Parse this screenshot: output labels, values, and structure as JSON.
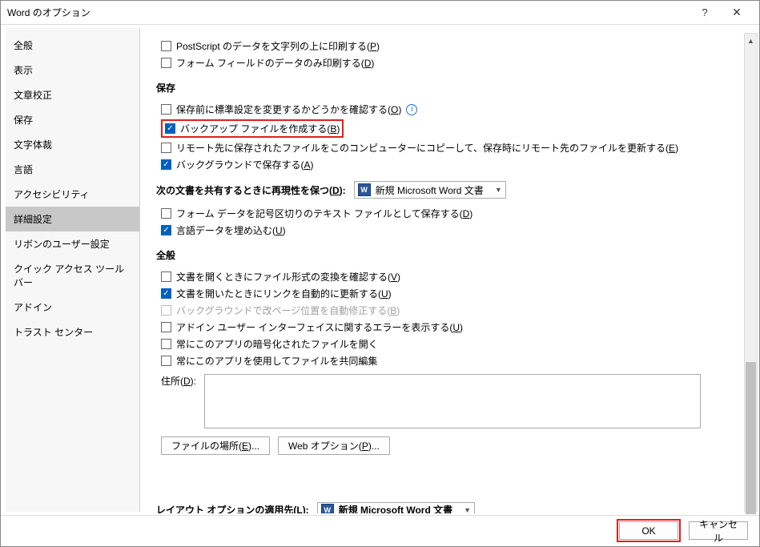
{
  "window": {
    "title": "Word のオプション"
  },
  "sidebar": {
    "items": [
      {
        "label": "全般"
      },
      {
        "label": "表示"
      },
      {
        "label": "文章校正"
      },
      {
        "label": "保存"
      },
      {
        "label": "文字体裁"
      },
      {
        "label": "言語"
      },
      {
        "label": "アクセシビリティ"
      },
      {
        "label": "詳細設定"
      },
      {
        "label": "リボンのユーザー設定"
      },
      {
        "label": "クイック アクセス ツール バー"
      },
      {
        "label": "アドイン"
      },
      {
        "label": "トラスト センター"
      }
    ],
    "selected_index": 7
  },
  "top_checks": [
    {
      "label": "PostScript のデータを文字列の上に印刷する(",
      "accel": "P",
      "suffix": ")",
      "checked": false
    },
    {
      "label": "フォーム フィールドのデータのみ印刷する(",
      "accel": "D",
      "suffix": ")",
      "checked": false
    }
  ],
  "sections": {
    "save": {
      "title": "保存",
      "items": [
        {
          "label": "保存前に標準設定を変更するかどうかを確認する(",
          "accel": "O",
          "suffix": ")",
          "checked": false,
          "info": true
        },
        {
          "label": "バックアップ ファイルを作成する(",
          "accel": "B",
          "suffix": ")",
          "checked": true,
          "highlighted": true
        },
        {
          "label": "リモート先に保存されたファイルをこのコンピューターにコピーして、保存時にリモート先のファイルを更新する(",
          "accel": "E",
          "suffix": ")",
          "checked": false
        },
        {
          "label": "バックグラウンドで保存する(",
          "accel": "A",
          "suffix": ")",
          "checked": true
        }
      ]
    },
    "share": {
      "label": "次の文書を共有するときに再現性を保つ(",
      "accel": "D",
      "suffix": "):",
      "dropdown": {
        "icon": "W",
        "text": "新規 Microsoft Word 文書"
      },
      "items": [
        {
          "label": "フォーム データを記号区切りのテキスト ファイルとして保存する(",
          "accel": "D",
          "suffix": ")",
          "checked": false
        },
        {
          "label": "言語データを埋め込む(",
          "accel": "U",
          "suffix": ")",
          "checked": true
        }
      ]
    },
    "general": {
      "title": "全般",
      "items": [
        {
          "label": "文書を開くときにファイル形式の変換を確認する(",
          "accel": "V",
          "suffix": ")",
          "checked": false
        },
        {
          "label": "文書を開いたときにリンクを自動的に更新する(",
          "accel": "U",
          "suffix": ")",
          "checked": true
        },
        {
          "label": "バックグラウンドで改ページ位置を自動修正する(",
          "accel": "B",
          "suffix": ")",
          "checked": false,
          "disabled": true
        },
        {
          "label": "アドイン ユーザー インターフェイスに関するエラーを表示する(",
          "accel": "U",
          "suffix": ")",
          "checked": false
        },
        {
          "label": "常にこのアプリの暗号化されたファイルを開く",
          "accel": "",
          "suffix": "",
          "checked": false
        },
        {
          "label": "常にこのアプリを使用してファイルを共同編集",
          "accel": "",
          "suffix": "",
          "checked": false
        }
      ],
      "address": {
        "label": "住所(",
        "accel": "D",
        "suffix": "):",
        "value": ""
      },
      "buttons": [
        {
          "label": "ファイルの場所(",
          "accel": "E",
          "suffix": ")..."
        },
        {
          "label": "Web オプション(",
          "accel": "P",
          "suffix": ")..."
        }
      ]
    },
    "cutoff": {
      "label": "レイアウト オプションの適用先(",
      "accel": "L",
      "suffix": "):",
      "dropdown": {
        "icon": "W",
        "text": "新規 Microsoft Word 文書"
      }
    }
  },
  "footer": {
    "ok": "OK",
    "cancel": "キャンセル"
  }
}
